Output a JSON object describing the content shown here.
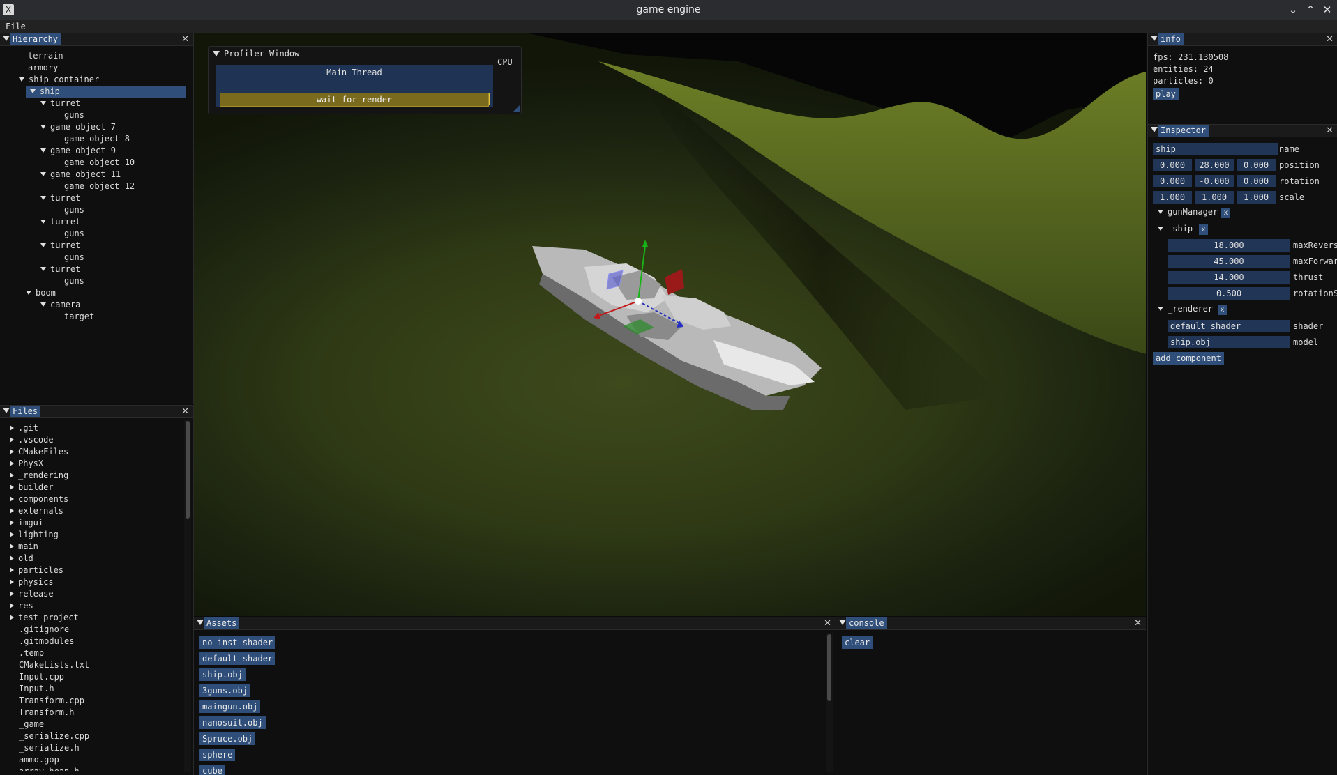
{
  "window": {
    "title": "game engine",
    "app_icon": "X",
    "controls": [
      "chevron-down-icon",
      "chevron-up-icon",
      "close-icon"
    ]
  },
  "menu": {
    "file": "File"
  },
  "hierarchy": {
    "tab": "Hierarchy",
    "items": [
      {
        "label": "terrain",
        "level": 1,
        "toggle": "none",
        "selected": false
      },
      {
        "label": "armory",
        "level": 1,
        "toggle": "none",
        "selected": false
      },
      {
        "label": "ship container",
        "level": 1,
        "toggle": "open",
        "selected": false
      },
      {
        "label": "ship",
        "level": 2,
        "toggle": "open",
        "selected": true
      },
      {
        "label": "turret",
        "level": 3,
        "toggle": "open",
        "selected": false
      },
      {
        "label": "guns",
        "level": 4,
        "toggle": "none",
        "selected": false
      },
      {
        "label": "game object 7",
        "level": 3,
        "toggle": "open",
        "selected": false
      },
      {
        "label": "game object 8",
        "level": 4,
        "toggle": "none",
        "selected": false
      },
      {
        "label": "game object 9",
        "level": 3,
        "toggle": "open",
        "selected": false
      },
      {
        "label": "game object 10",
        "level": 4,
        "toggle": "none",
        "selected": false
      },
      {
        "label": "game object 11",
        "level": 3,
        "toggle": "open",
        "selected": false
      },
      {
        "label": "game object 12",
        "level": 4,
        "toggle": "none",
        "selected": false
      },
      {
        "label": "turret",
        "level": 3,
        "toggle": "open",
        "selected": false
      },
      {
        "label": "guns",
        "level": 4,
        "toggle": "none",
        "selected": false
      },
      {
        "label": "turret",
        "level": 3,
        "toggle": "open",
        "selected": false
      },
      {
        "label": "guns",
        "level": 4,
        "toggle": "none",
        "selected": false
      },
      {
        "label": "turret",
        "level": 3,
        "toggle": "open",
        "selected": false
      },
      {
        "label": "guns",
        "level": 4,
        "toggle": "none",
        "selected": false
      },
      {
        "label": "turret",
        "level": 3,
        "toggle": "open",
        "selected": false
      },
      {
        "label": "guns",
        "level": 4,
        "toggle": "none",
        "selected": false
      },
      {
        "label": "boom",
        "level": 2,
        "toggle": "open",
        "selected": false
      },
      {
        "label": "camera",
        "level": 3,
        "toggle": "open",
        "selected": false
      },
      {
        "label": "target",
        "level": 4,
        "toggle": "none",
        "selected": false
      }
    ]
  },
  "files": {
    "tab": "Files",
    "folders": [
      ".git",
      ".vscode",
      "CMakeFiles",
      "PhysX",
      "_rendering",
      "builder",
      "components",
      "externals",
      "imgui",
      "lighting",
      "main",
      "old",
      "particles",
      "physics",
      "release",
      "res",
      "test_project"
    ],
    "files": [
      ".gitignore",
      ".gitmodules",
      ".temp",
      "CMakeLists.txt",
      "Input.cpp",
      "Input.h",
      "Transform.cpp",
      "Transform.h",
      "_game",
      "_serialize.cpp",
      "_serialize.h",
      "ammo.gop",
      "array_heap.h"
    ]
  },
  "profiler": {
    "title": "Profiler Window",
    "thread": "Main Thread",
    "cpu_label": "CPU",
    "bar_label": "wait for render"
  },
  "info": {
    "tab": "info",
    "fps": "fps: 231.130508",
    "entities": "entities: 24",
    "particles": "particles: 0",
    "play": "play"
  },
  "inspector": {
    "tab": "Inspector",
    "name_value": "ship",
    "name_label": "name",
    "position": [
      "0.000",
      "28.000",
      "0.000"
    ],
    "position_label": "position",
    "rotation": [
      "0.000",
      "-0.000",
      "0.000"
    ],
    "rotation_label": "rotation",
    "scale": [
      "1.000",
      "1.000",
      "1.000"
    ],
    "scale_label": "scale",
    "gun_manager": "gunManager",
    "ship_component": "_ship",
    "ship_fields": [
      {
        "value": "18.000",
        "label": "maxRevers"
      },
      {
        "value": "45.000",
        "label": "maxForwar"
      },
      {
        "value": "14.000",
        "label": "thrust"
      },
      {
        "value": "0.500",
        "label": "rotationS"
      }
    ],
    "renderer_component": "_renderer",
    "renderer_fields": [
      {
        "value": "default shader",
        "label": "shader"
      },
      {
        "value": "ship.obj",
        "label": "model"
      }
    ],
    "remove_label": "x",
    "add_component": "add component"
  },
  "assets": {
    "tab": "Assets",
    "items": [
      "no_inst shader",
      "default shader",
      "ship.obj",
      "3guns.obj",
      "maingun.obj",
      "nanosuit.obj",
      "Spruce.obj",
      "sphere",
      "cube"
    ]
  },
  "console": {
    "tab": "console",
    "clear": "clear"
  },
  "colors": {
    "accent": "#2f4f7a",
    "field": "#213656",
    "panel_bg": "#0f0f0f",
    "profiler_bar": "#7a6a1e",
    "terrain": "#3e4a1c"
  }
}
